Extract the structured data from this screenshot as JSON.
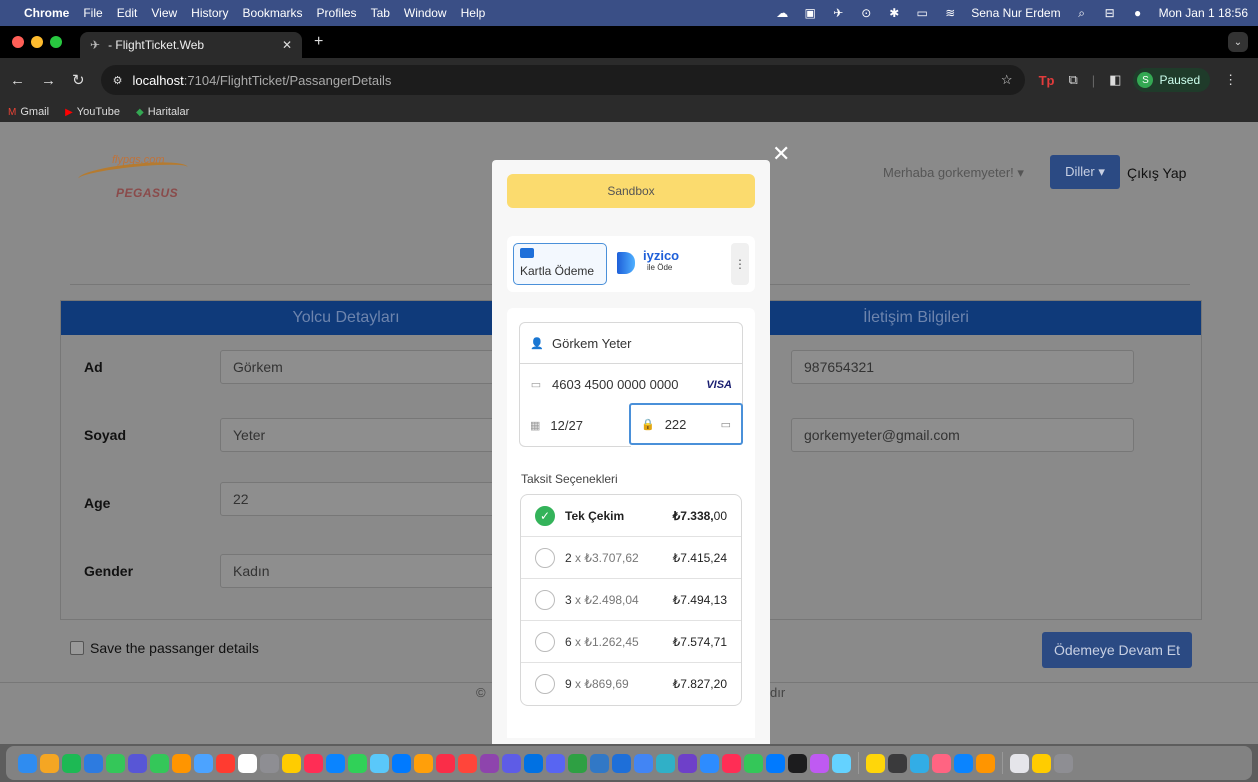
{
  "menubar": {
    "apple": "",
    "app_name": "Chrome",
    "menus": [
      "File",
      "Edit",
      "View",
      "History",
      "Bookmarks",
      "Profiles",
      "Tab",
      "Window",
      "Help"
    ],
    "user": "Sena Nur Erdem",
    "clock": "Mon Jan 1  18:56"
  },
  "browser": {
    "tab_title": "- FlightTicket.Web",
    "url_host": "localhost",
    "url_path": ":7104/FlightTicket/PassangerDetails",
    "profile_initial": "S",
    "profile_status": "Paused",
    "bookmarks": [
      {
        "label": "Gmail",
        "icon": "gmail-icon",
        "color": "#ea4335"
      },
      {
        "label": "YouTube",
        "icon": "youtube-icon",
        "color": "#ff0000"
      },
      {
        "label": "Haritalar",
        "icon": "maps-icon",
        "color": "#34a853"
      }
    ]
  },
  "site": {
    "logo_top": "flypgs.com",
    "logo_bottom": "PEGASUS",
    "greeting": "Merhaba gorkemyeter! ▾",
    "languages_label": "Diller ▾",
    "logout_label": "Çıkış Yap"
  },
  "passenger_panel": {
    "left_title": "Yolcu Detayları",
    "right_title": "İletişim Bilgileri",
    "fields": [
      {
        "label": "Ad",
        "value": "Görkem"
      },
      {
        "label": "Soyad",
        "value": "Yeter"
      },
      {
        "label": "Age",
        "value": "22"
      },
      {
        "label": "Gender",
        "value": "Kadın"
      }
    ],
    "phone_value": "987654321",
    "email_value": "gorkemyeter@gmail.com",
    "save_label": "Save the passanger details",
    "continue_label": "Ödemeye Devam Et",
    "footer_left": "©",
    "footer_right": "dır"
  },
  "payment": {
    "sandbox_label": "Sandbox",
    "card_method_label": "Kartla Ödeme",
    "iyzico_brand": "iyzico",
    "iyzico_sub": "ile Öde",
    "more_icon": "⋮",
    "cardholder": "Görkem Yeter",
    "card_number": "4603 4500 0000 0000",
    "card_brand": "VISA",
    "expiry": "12/27",
    "cvc": "222",
    "installments_title": "Taksit Seçenekleri",
    "installments": [
      {
        "count": "",
        "label": "Tek Çekim",
        "per": "",
        "per_dec": "",
        "total": "₺7.338,",
        "total_dec": "00",
        "selected": true
      },
      {
        "count": "2",
        "label": "x",
        "per": "₺3.707,",
        "per_dec": "62",
        "total": "₺7.415,",
        "total_dec": "24",
        "selected": false
      },
      {
        "count": "3",
        "label": "x",
        "per": "₺2.498,",
        "per_dec": "04",
        "total": "₺7.494,",
        "total_dec": "13",
        "selected": false
      },
      {
        "count": "6",
        "label": "x",
        "per": "₺1.262,",
        "per_dec": "45",
        "total": "₺7.574,",
        "total_dec": "71",
        "selected": false
      },
      {
        "count": "9",
        "label": "x",
        "per": "₺869,",
        "per_dec": "69",
        "total": "₺7.827,",
        "total_dec": "20",
        "selected": false
      }
    ]
  },
  "dock": {
    "colors": [
      "#2f8cf0",
      "#f5a623",
      "#1db954",
      "#2d7be0",
      "#34c759",
      "#5856d6",
      "#34c759",
      "#ff9500",
      "#4ca3ff",
      "#ff3b30",
      "#ffffff",
      "#8e8e93",
      "#ffcc00",
      "#ff2d55",
      "#0a84ff",
      "#30d158",
      "#5ac8fa",
      "#007aff",
      "#ff9f0a",
      "#fa2d48",
      "#ff453a",
      "#8e44ad",
      "#5e5ce6",
      "#0071e3",
      "#5865f2",
      "#2ea043",
      "#3178c6",
      "#1e6fd9",
      "#4285f4",
      "#30b0c7",
      "#6e40c9",
      "#2d8cff",
      "#ff2d55",
      "#34c759",
      "#007aff",
      "#1c1c1e",
      "#bf5af2",
      "#64d2ff",
      "#ffd60a",
      "#3a3a3c",
      "#32ade6",
      "#ff6482",
      "#0a84ff",
      "#ff9500",
      "#e5e5ea",
      "#ffcc00",
      "#8e8e93"
    ]
  }
}
